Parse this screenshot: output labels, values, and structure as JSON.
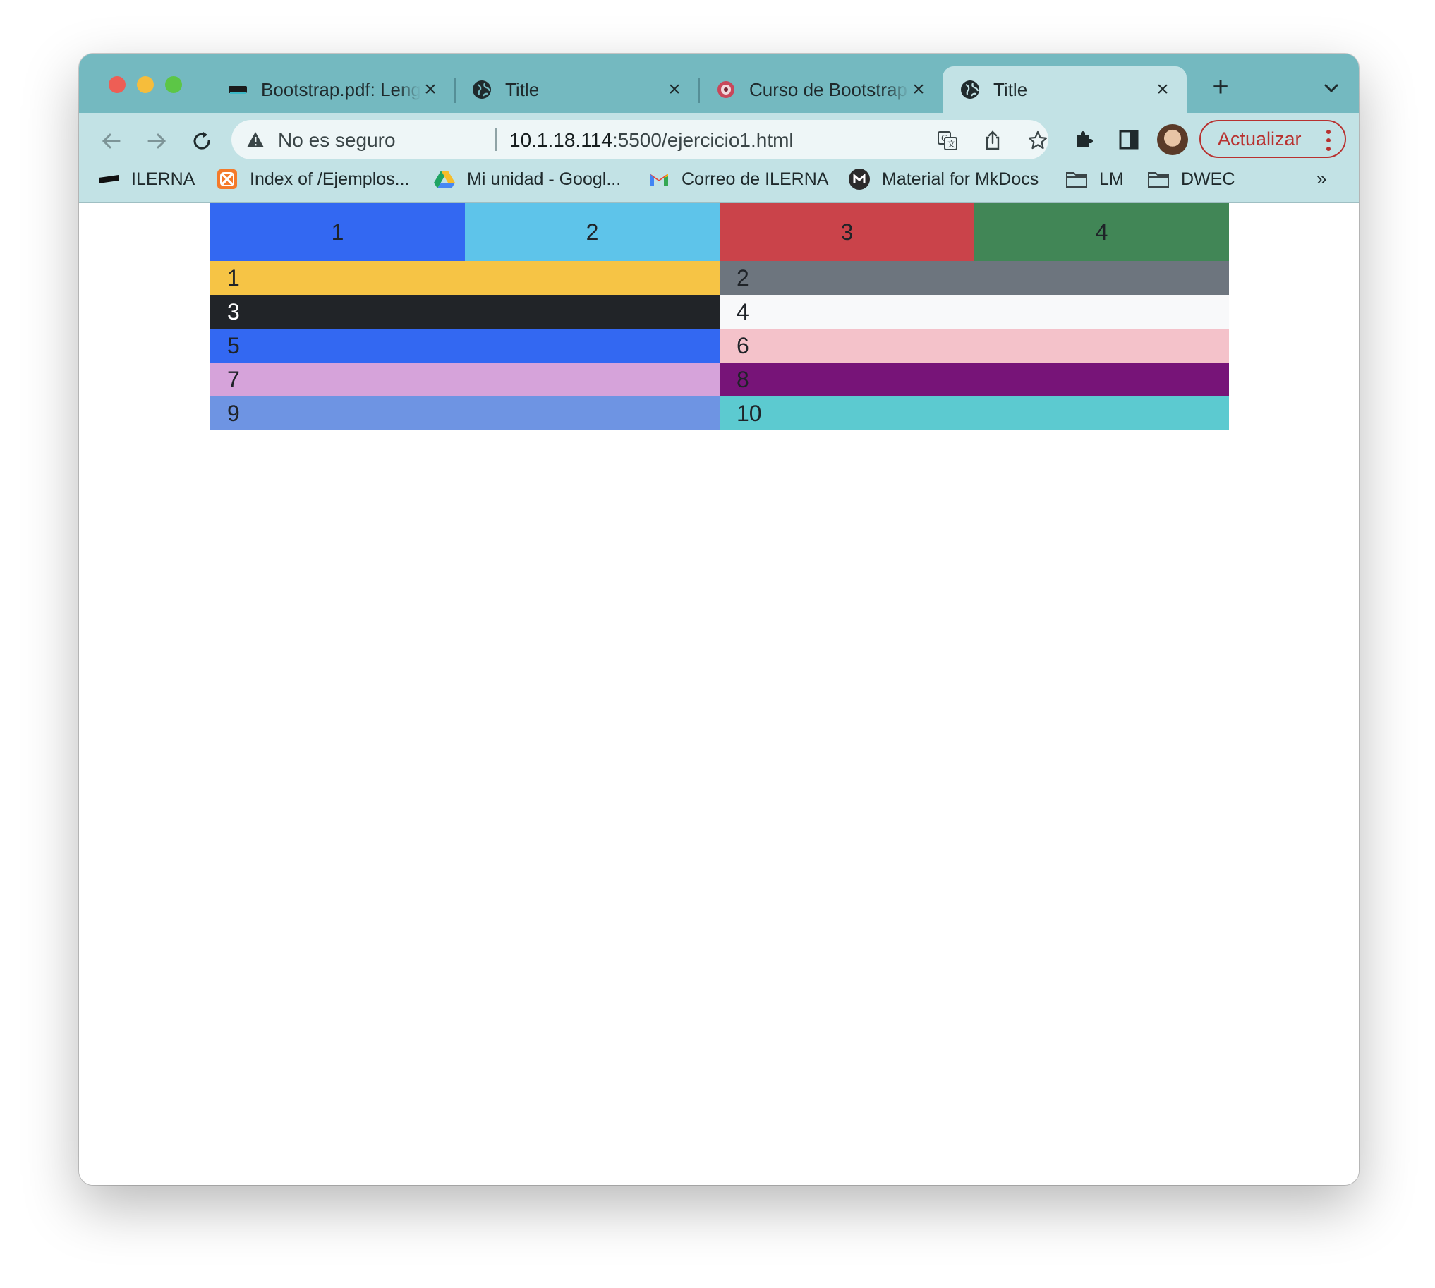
{
  "tabs": [
    {
      "label": "Bootstrap.pdf: Lenguajes de marcas",
      "favicon": "ilerna-icon",
      "active": false
    },
    {
      "label": "Title",
      "favicon": "globe-icon",
      "active": false
    },
    {
      "label": "Curso de Bootstrap",
      "favicon": "bootstrap-course-icon",
      "active": false
    },
    {
      "label": "Title",
      "favicon": "globe-icon",
      "active": true
    }
  ],
  "omnibox": {
    "security_label": "No es seguro",
    "url_host": "10.1.18.114",
    "url_rest": ":5500/ejercicio1.html"
  },
  "toolbar": {
    "update_label": "Actualizar"
  },
  "bookmarks": [
    {
      "label": "ILERNA",
      "icon": "ilerna-icon"
    },
    {
      "label": "Index of /Ejemplos...",
      "icon": "xampp-icon"
    },
    {
      "label": "Mi unidad - Googl...",
      "icon": "google-drive-icon"
    },
    {
      "label": "Correo de ILERNA",
      "icon": "gmail-icon"
    },
    {
      "label": "Material for MkDocs",
      "icon": "mkdocs-icon"
    },
    {
      "label": "LM",
      "icon": "folder-icon"
    },
    {
      "label": "DWEC",
      "icon": "folder-icon"
    }
  ],
  "colors": {
    "accent": "#b8312f",
    "tabstrip": "#74b9c0",
    "toolbar": "#c2e2e5"
  },
  "grid": {
    "header": [
      {
        "text": "1",
        "bg": "#3368f2"
      },
      {
        "text": "2",
        "bg": "#5ec4ea"
      },
      {
        "text": "3",
        "bg": "#ca434a"
      },
      {
        "text": "4",
        "bg": "#418656"
      }
    ],
    "rows": [
      [
        {
          "text": "1",
          "bg": "#f6c445"
        },
        {
          "text": "2",
          "bg": "#6d757e"
        }
      ],
      [
        {
          "text": "3",
          "bg": "#212428",
          "light": true
        },
        {
          "text": "4",
          "bg": "#f8f9fa"
        }
      ],
      [
        {
          "text": "5",
          "bg": "#3368f2"
        },
        {
          "text": "6",
          "bg": "#f4c2ca"
        }
      ],
      [
        {
          "text": "7",
          "bg": "#d6a3da"
        },
        {
          "text": "8",
          "bg": "#771478"
        }
      ],
      [
        {
          "text": "9",
          "bg": "#6e94e3"
        },
        {
          "text": "10",
          "bg": "#5ccad0"
        }
      ]
    ]
  }
}
